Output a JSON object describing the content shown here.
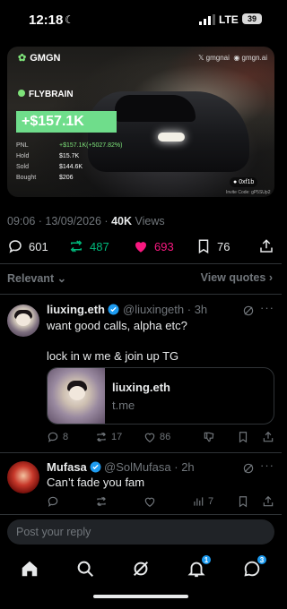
{
  "status_bar": {
    "time": "12:18",
    "network": "LTE",
    "battery": "39"
  },
  "card": {
    "brand": "GMGN",
    "handles": [
      "gmgnai",
      "gmgn.ai"
    ],
    "token": "FLYBRAIN",
    "pnl_big": "+$157.1K",
    "stats": [
      {
        "k": "PNL",
        "v": "+$157.1K(+5027.82%)"
      },
      {
        "k": "Hold",
        "v": "$15.7K"
      },
      {
        "k": "Sold",
        "v": "$144.6K"
      },
      {
        "k": "Bought",
        "v": "$206"
      }
    ],
    "wallet_pill": "0xf1b",
    "invite": "Invite Code: gP5SUp2"
  },
  "post_meta": {
    "time": "09:06",
    "date": "13/09/2026",
    "views_count": "40K",
    "views_label": "Views"
  },
  "post_actions": {
    "replies": "601",
    "reposts": "487",
    "likes": "693",
    "bookmarks": "76"
  },
  "sort": {
    "label": "Relevant",
    "view_quotes": "View quotes"
  },
  "reply1": {
    "name": "liuxing.eth",
    "handle": "@liuxingeth",
    "age": "3h",
    "line1": "want good calls, alpha etc?",
    "line2": "lock in w me & join up TG",
    "link_title": "liuxing.eth",
    "link_domain": "t.me",
    "replies": "8",
    "reposts": "17",
    "likes": "86"
  },
  "reply2": {
    "name": "Mufasa",
    "handle": "@SolMufasa",
    "age": "2h",
    "text": "Can’t fade you fam",
    "views": "7"
  },
  "reply_box": {
    "placeholder": "Post your reply"
  },
  "tabbar": {
    "notifications_badge": "1",
    "messages_badge": "3"
  },
  "colors": {
    "accent": "#1d9bf0",
    "repost_green": "#00ba7c",
    "like_pink": "#f91880",
    "pnl_green": "#6fdd8b"
  }
}
